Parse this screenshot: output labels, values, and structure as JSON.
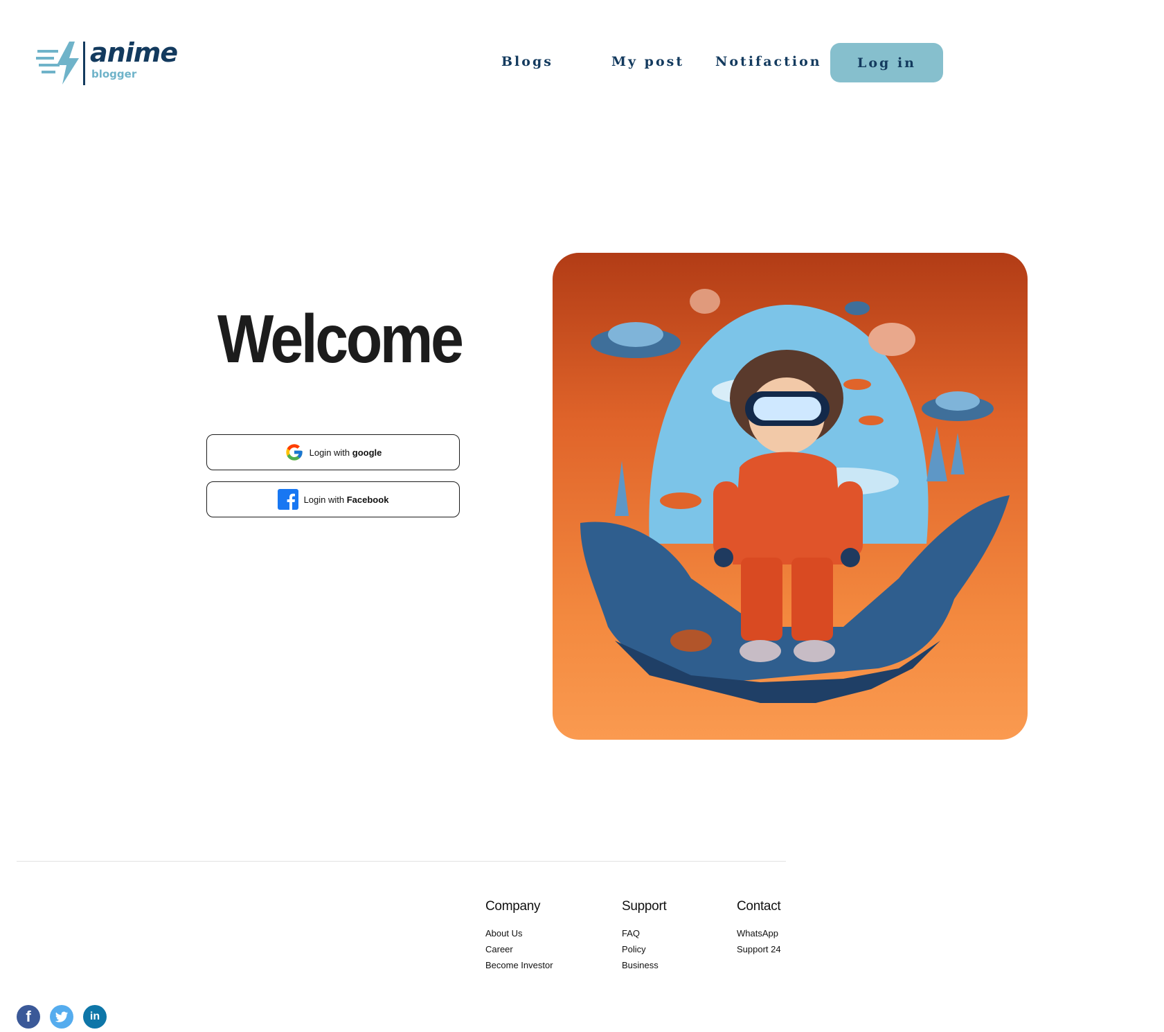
{
  "brand": {
    "name": "anime",
    "tagline": "blogger",
    "primary_color": "#133a5e",
    "accent_color": "#86bfcd"
  },
  "nav": {
    "items": [
      {
        "label": "Blogs"
      },
      {
        "label": "My post"
      },
      {
        "label": "Notifaction"
      }
    ],
    "login_label": "Log in"
  },
  "main": {
    "title": "Welcome",
    "auth": {
      "google": {
        "prefix": "Login with ",
        "provider": "google",
        "icon": "google-icon"
      },
      "facebook": {
        "prefix": "Login with ",
        "provider": "Facebook",
        "icon": "facebook-icon"
      }
    },
    "hero_image": {
      "description_icon": "anime-character-illustration"
    }
  },
  "footer": {
    "columns": [
      {
        "title": "Company",
        "links": [
          "About Us",
          "Career",
          "Become Investor"
        ]
      },
      {
        "title": "Support",
        "links": [
          "FAQ",
          "Policy",
          "Business"
        ]
      },
      {
        "title": "Contact",
        "links": [
          "WhatsApp",
          "Support 24"
        ]
      }
    ],
    "social": [
      {
        "icon": "facebook-icon",
        "glyph": "f"
      },
      {
        "icon": "twitter-icon",
        "glyph": "t"
      },
      {
        "icon": "linkedin-icon",
        "glyph": "in"
      }
    ]
  }
}
